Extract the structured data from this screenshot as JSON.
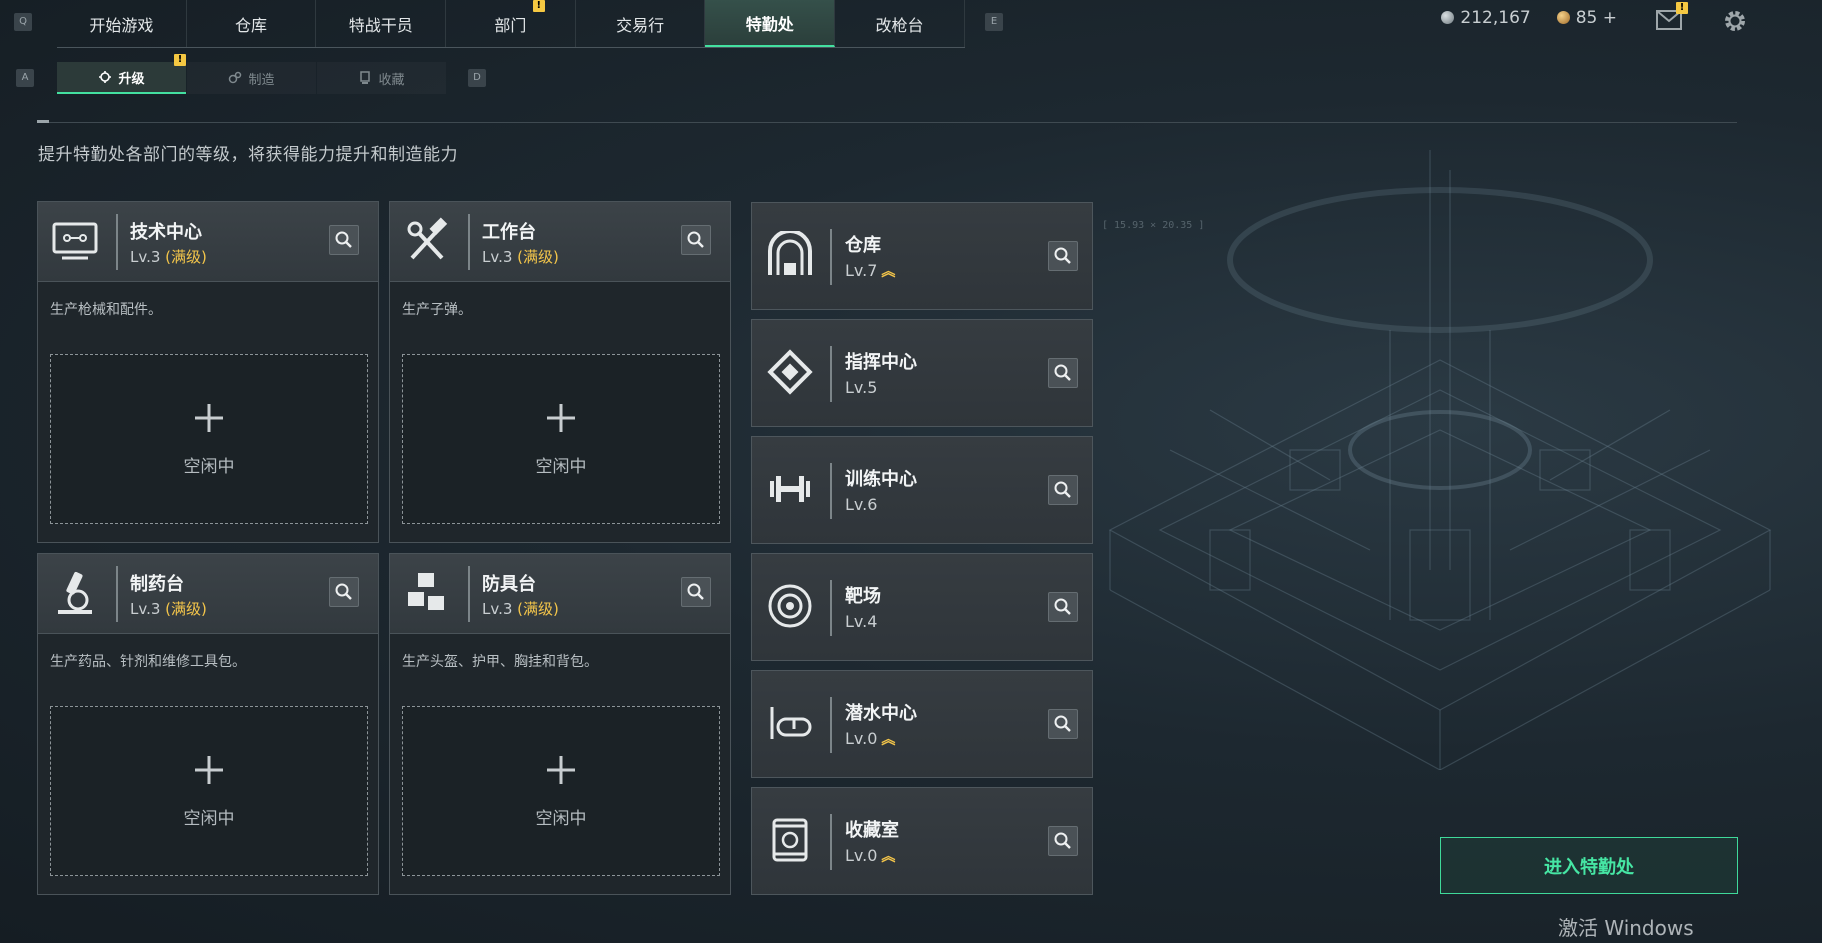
{
  "hotkeys": {
    "left_main": "Q",
    "right_main": "E",
    "left_sub": "A",
    "right_sub": "D"
  },
  "topnav": {
    "tabs": [
      {
        "label": "开始游戏"
      },
      {
        "label": "仓库"
      },
      {
        "label": "特战干员"
      },
      {
        "label": "部门",
        "badge": "!"
      },
      {
        "label": "交易行"
      },
      {
        "label": "特勤处",
        "active": true
      },
      {
        "label": "改枪台"
      }
    ]
  },
  "subnav": {
    "tabs": [
      {
        "label": "升级",
        "icon": "wrench-gear-icon",
        "active": true,
        "badge": "!"
      },
      {
        "label": "制造",
        "icon": "gears-icon"
      },
      {
        "label": "收藏",
        "icon": "trophy-icon"
      }
    ]
  },
  "currency": {
    "silver": "212,167",
    "gold": "85 +"
  },
  "mail_badge": "!",
  "intro_text": "提升特勤处各部门的等级，将获得能力提升和制造能力",
  "big_cards": [
    {
      "title": "技术中心",
      "level": "Lv.3",
      "max": "(满级)",
      "desc": "生产枪械和配件。",
      "idle": "空闲中",
      "icon": "computer-icon"
    },
    {
      "title": "工作台",
      "level": "Lv.3",
      "max": "(满级)",
      "desc": "生产子弹。",
      "idle": "空闲中",
      "icon": "hammer-wrench-icon"
    },
    {
      "title": "制药台",
      "level": "Lv.3",
      "max": "(满级)",
      "desc": "生产药品、针剂和维修工具包。",
      "idle": "空闲中",
      "icon": "microscope-icon"
    },
    {
      "title": "防具台",
      "level": "Lv.3",
      "max": "(满级)",
      "desc": "生产头盔、护甲、胸挂和背包。",
      "idle": "空闲中",
      "icon": "boxes-icon"
    }
  ],
  "small_cards": [
    {
      "title": "仓库",
      "level": "Lv.7",
      "upgradable": true,
      "icon": "warehouse-icon"
    },
    {
      "title": "指挥中心",
      "level": "Lv.5",
      "upgradable": false,
      "icon": "command-emblem-icon"
    },
    {
      "title": "训练中心",
      "level": "Lv.6",
      "upgradable": false,
      "icon": "dumbbell-icon"
    },
    {
      "title": "靶场",
      "level": "Lv.4",
      "upgradable": false,
      "icon": "target-icon"
    },
    {
      "title": "潜水中心",
      "level": "Lv.0",
      "upgradable": true,
      "icon": "diving-mask-icon"
    },
    {
      "title": "收藏室",
      "level": "Lv.0",
      "upgradable": true,
      "icon": "display-case-icon"
    }
  ],
  "enter_button": "进入特勤处",
  "coords_label": "[ 15.93 × 20.35 ]",
  "watermark": "激活 Windows",
  "colors": {
    "accent": "#43e0a0",
    "warning": "#f3c54a",
    "badge": "#f5c842"
  }
}
